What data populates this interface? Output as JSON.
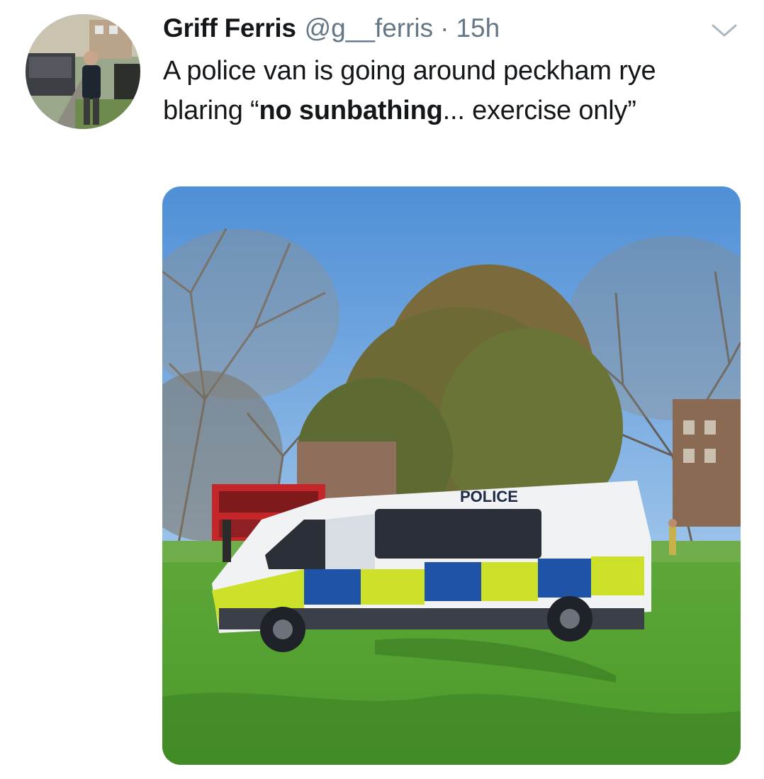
{
  "tweet": {
    "display_name": "Griff Ferris",
    "handle": "@g__ferris",
    "separator": "·",
    "time": "15h",
    "text_part1": "A police van is going around peckham rye blaring “",
    "text_bold": "no sunbathing",
    "text_part2": "... exercise only”"
  },
  "avatar": {
    "description_icon": "profile-photo"
  },
  "media": {
    "van_label": "POLICE"
  },
  "icons": {
    "caret": "chevron-down-icon"
  },
  "colors": {
    "name": "#14171a",
    "meta": "#657786",
    "caret": "#aab8c2"
  }
}
